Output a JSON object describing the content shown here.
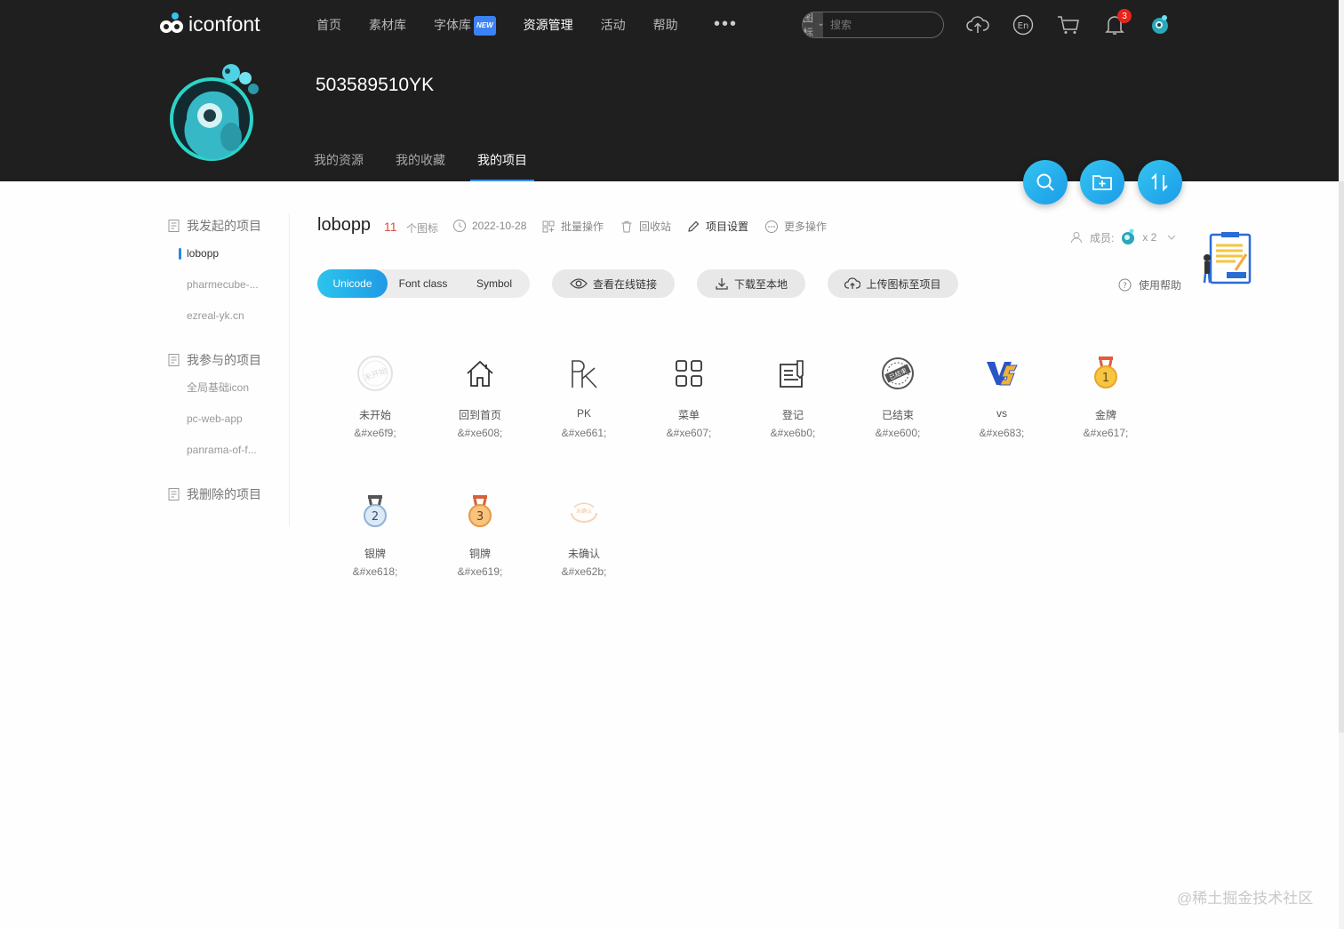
{
  "header": {
    "logo_text": "iconfont",
    "nav": [
      {
        "label": "首页"
      },
      {
        "label": "素材库"
      },
      {
        "label": "字体库",
        "badge": "NEW"
      },
      {
        "label": "资源管理",
        "active": true
      },
      {
        "label": "活动"
      },
      {
        "label": "帮助"
      }
    ],
    "more": "•••",
    "search": {
      "type_label": "图标",
      "placeholder": "搜索"
    },
    "notification_count": "3"
  },
  "profile": {
    "username": "503589510YK",
    "tabs": [
      "我的资源",
      "我的收藏",
      "我的项目"
    ],
    "active_tab": "我的项目"
  },
  "sidebar": {
    "groups": [
      {
        "title": "我发起的项目",
        "items": [
          "lobopp",
          "pharmecube-...",
          "ezreal-yk.cn"
        ]
      },
      {
        "title": "我参与的项目",
        "items": [
          "全局基础icon",
          "pc-web-app",
          "panrama-of-f..."
        ]
      },
      {
        "title": "我删除的项目",
        "items": []
      }
    ],
    "active_item": "lobopp"
  },
  "project": {
    "name": "lobopp",
    "count": "11",
    "count_unit": "个图标",
    "date": "2022-10-28",
    "batch": "批量操作",
    "recycle": "回收站",
    "settings": "项目设置",
    "more_ops": "更多操作",
    "members_label": "成员:",
    "members_count": "x 2",
    "help": "使用帮助"
  },
  "toolbar": {
    "segments": [
      "Unicode",
      "Font class",
      "Symbol"
    ],
    "active_segment": "Unicode",
    "view_link": "查看在线链接",
    "download": "下载至本地",
    "upload": "上传图标至项目"
  },
  "icons": [
    {
      "name": "未开始",
      "code": "&#xe6f9;",
      "icon": "stamp-not-started-icon"
    },
    {
      "name": "回到首页",
      "code": "&#xe608;",
      "icon": "home-icon"
    },
    {
      "name": "PK",
      "code": "&#xe661;",
      "icon": "pk-icon"
    },
    {
      "name": "菜单",
      "code": "&#xe607;",
      "icon": "menu-grid-icon"
    },
    {
      "name": "登记",
      "code": "&#xe6b0;",
      "icon": "register-icon"
    },
    {
      "name": "已结束",
      "code": "&#xe600;",
      "icon": "stamp-ended-icon"
    },
    {
      "name": "vs",
      "code": "&#xe683;",
      "icon": "vs-icon"
    },
    {
      "name": "金牌",
      "code": "&#xe617;",
      "icon": "gold-medal-icon"
    },
    {
      "name": "银牌",
      "code": "&#xe618;",
      "icon": "silver-medal-icon"
    },
    {
      "name": "铜牌",
      "code": "&#xe619;",
      "icon": "bronze-medal-icon"
    },
    {
      "name": "未确认",
      "code": "&#xe62b;",
      "icon": "stamp-unconfirmed-icon"
    }
  ],
  "watermark": "@稀土掘金技术社区"
}
